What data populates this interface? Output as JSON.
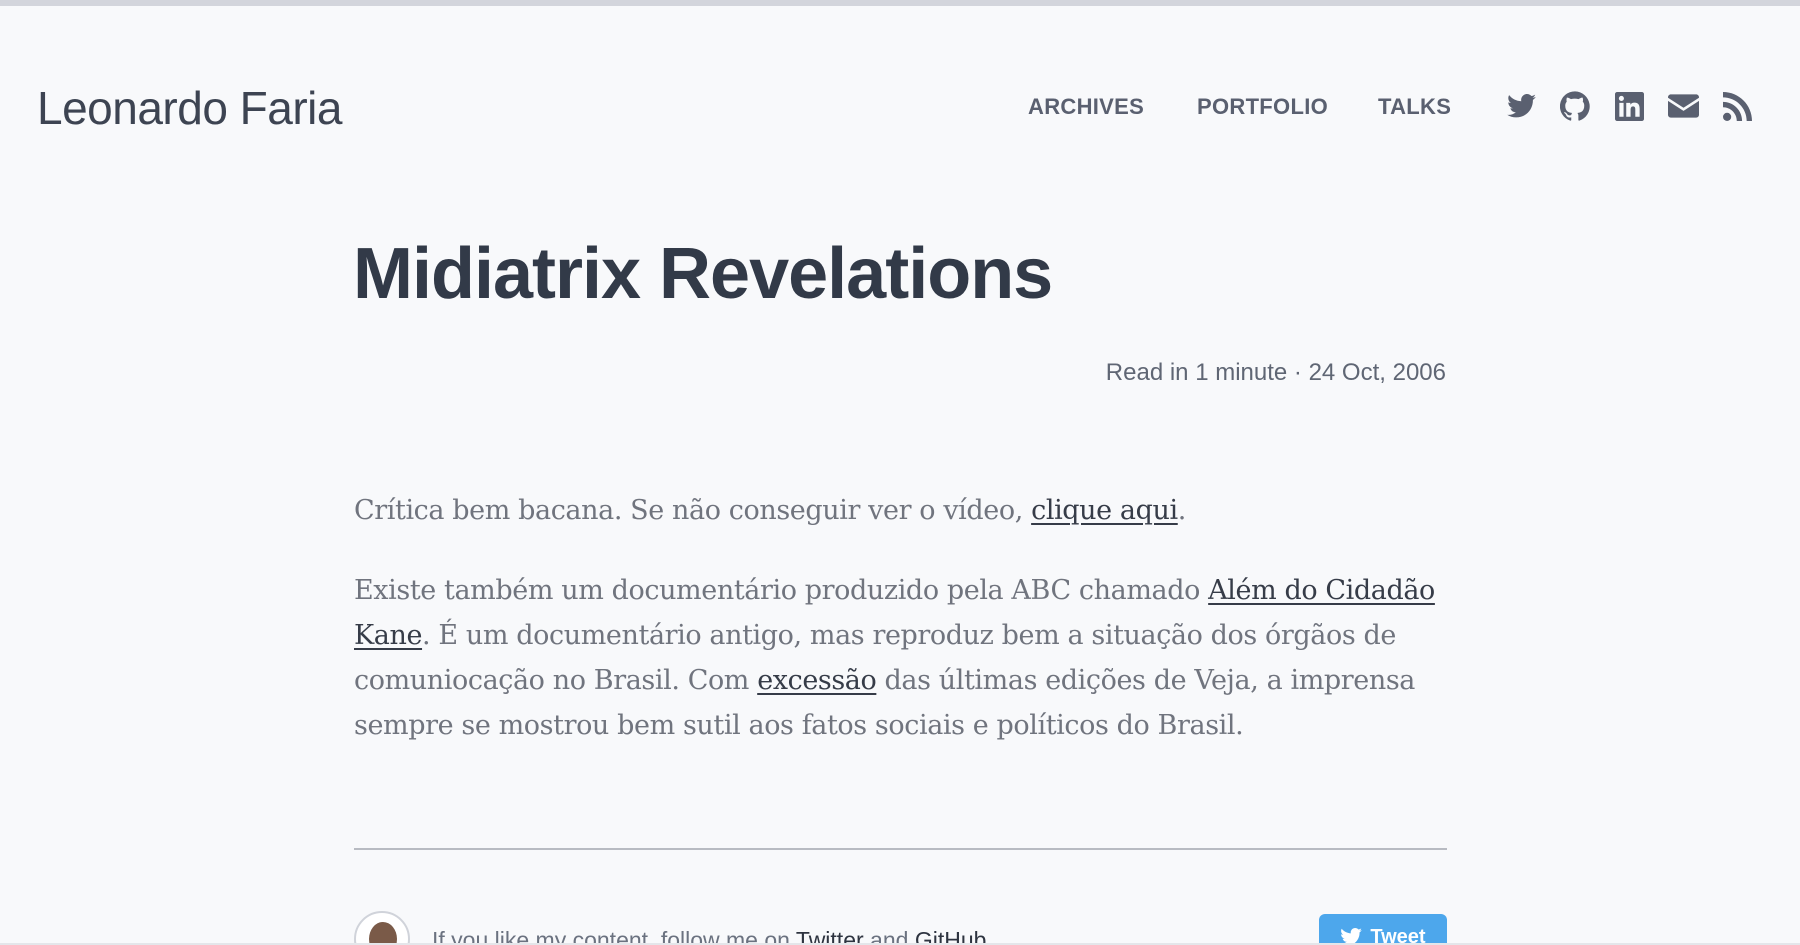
{
  "header": {
    "site_title": "Leonardo Faria",
    "nav": [
      {
        "label": "ARCHIVES"
      },
      {
        "label": "PORTFOLIO"
      },
      {
        "label": "TALKS"
      }
    ],
    "social_icons": [
      "twitter-icon",
      "github-icon",
      "linkedin-icon",
      "email-icon",
      "rss-icon"
    ]
  },
  "post": {
    "title": "Midiatrix Revelations",
    "meta": "Read in 1 minute · 24 Oct, 2006",
    "paragraph1": {
      "text": "Crítica bem bacana. Se não conseguir ver o vídeo, ",
      "link": "clique aqui",
      "end": "."
    },
    "paragraph2": {
      "text_a": "Existe também um documentário produzido pela ABC chamado ",
      "link_a": "Além do Cidadão Kane",
      "text_b": ". É um documentário antigo, mas reproduz bem a situação dos órgãos de comuniocação no Brasil. Com ",
      "link_b": "excessão",
      "text_c": " das últimas edições de Veja, a imprensa sempre se mostrou bem sutil aos fatos sociais e políticos do Brasil."
    }
  },
  "footer": {
    "follow_prefix": "If you like my content, follow me on ",
    "twitter_link": "Twitter",
    "and": " and ",
    "github_link": "GitHub",
    "tweet_button": "Tweet"
  },
  "colors": {
    "background": "#f8f9fb",
    "title": "#323a48",
    "nav": "#5a6070",
    "tweet_button": "#4da7ec"
  }
}
